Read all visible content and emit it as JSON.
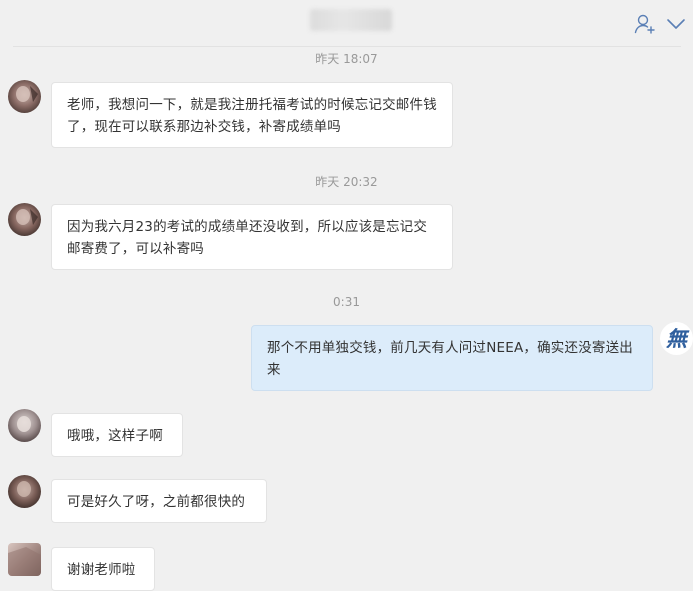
{
  "header": {
    "contact_name": "lu_chen",
    "add_contact_icon": "person-add-icon",
    "expand_icon": "chevron-down-icon"
  },
  "messages": [
    {
      "type": "time",
      "text": "昨天 18:07"
    },
    {
      "type": "msg",
      "sender": "other",
      "text": "老师，我想问一下，就是我注册托福考试的时候忘记交邮件钱了，现在可以联系那边补交钱，补寄成绩单吗"
    },
    {
      "type": "time",
      "text": "昨天 20:32"
    },
    {
      "type": "msg",
      "sender": "other",
      "text": "因为我六月23的考试的成绩单还没收到，所以应该是忘记交邮寄费了，可以补寄吗"
    },
    {
      "type": "time",
      "text": "0:31"
    },
    {
      "type": "msg",
      "sender": "self",
      "text": "那个不用单独交钱，前几天有人问过NEEA，确实还没寄送出来"
    },
    {
      "type": "msg",
      "sender": "other",
      "text": "哦哦，这样子啊"
    },
    {
      "type": "msg",
      "sender": "other",
      "text": "可是好久了呀，之前都很快的"
    },
    {
      "type": "msg",
      "sender": "other",
      "text": "谢谢老师啦"
    }
  ],
  "self_avatar": {
    "glyph": "無"
  },
  "colors": {
    "background": "#f0f0f0",
    "bubble_other": "#ffffff",
    "bubble_self": "#dcecfa",
    "text": "#333333",
    "timestamp": "#999999"
  }
}
